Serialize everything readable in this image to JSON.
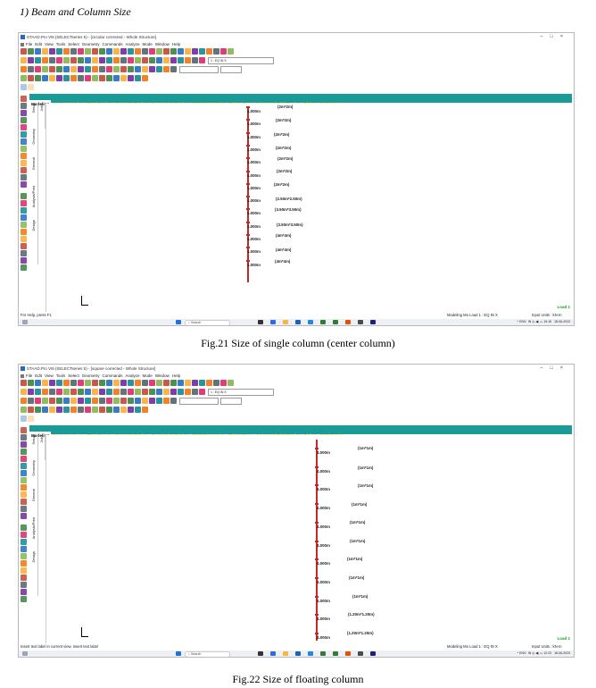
{
  "heading": "1)     Beam and Column Size",
  "captions": [
    "Fig.21 Size of single column (center column)",
    "Fig.22 Size of floating column"
  ],
  "windows": [
    {
      "title": "STAAD.Pro V8i (SELECTseries 5) - [circular corrected - Whole Structure]",
      "menu": [
        "File",
        "Edit",
        "View",
        "Tools",
        "Select",
        "Geometry",
        "Commands",
        "Analyze",
        "Mode",
        "Window",
        "Help"
      ],
      "load_combo": "1 : EQ IN X",
      "tabs": [
        "Modeling",
        "Postprocessing",
        "Steel Design",
        "Concrete Design",
        "Foundation Design",
        "RAM Connection",
        "Bridge Deck",
        "Advanced Slab Design",
        "Piping",
        "Earthquake"
      ],
      "side_tabs": [
        "Setup",
        "Geometry",
        "General",
        "Analysis/Print",
        "Design"
      ],
      "side_tabs2": [
        "Job"
      ],
      "heights": [
        "4.000m",
        "4.000m",
        "4.000m",
        "4.000m",
        "4.000m",
        "4.000m",
        "4.000m",
        "4.000m",
        "4.000m",
        "4.000m",
        "4.000m",
        "4.000m",
        "4.000m"
      ],
      "sizes": [
        "(2m*2m)",
        "(2m*2m)",
        "(2m*2m)",
        "(2m*2m)",
        "(2m*2m)",
        "(2m*2m)",
        "(2m*2m)",
        "(2.50m*2.50m)",
        "(3.50m*3.50m)",
        "(3.50m*3.50m)",
        "(4m*4m)",
        "(4m*4m)",
        "(4m*4m)"
      ],
      "load_label": "Load 1",
      "status_left": "For Help, press F1",
      "status_mid": "Modeling Mo Load 1 : EQ IN X",
      "status_right": "Input Units : kN-m",
      "search": "Search",
      "tray": {
        "lang": "ENG",
        "region": "IN",
        "time": "19:16",
        "date": "18-06-2023"
      }
    },
    {
      "title": "STAAD.Pro V8i (SELECTseries 5) - [square corrected - Whole Structure]",
      "menu": [
        "File",
        "Edit",
        "View",
        "Tools",
        "Select",
        "Geometry",
        "Commands",
        "Analyze",
        "Mode",
        "Window",
        "Help"
      ],
      "load_combo": "1 : EQ IN X",
      "tabs": [
        "Modeling",
        "Postprocessing",
        "Steel Design",
        "Concrete Design",
        "Foundation Design",
        "RAM Connection",
        "Bridge Deck",
        "Advanced Slab Design",
        "Piping",
        "Earthquake"
      ],
      "side_tabs": [
        "Setup",
        "Geometry",
        "General",
        "Analysis/Print",
        "Design"
      ],
      "side_tabs2": [
        "Job"
      ],
      "heights": [
        "4.000m",
        "4.000m",
        "4.000m",
        "4.000m",
        "4.000m",
        "4.000m",
        "4.000m",
        "4.000m",
        "4.000m",
        "4.000m",
        "4.000m"
      ],
      "sizes": [
        "(1m*1m)",
        "(1m*1m)",
        "(1m*1m)",
        "(1m*1m)",
        "(1m*1m)",
        "(1m*1m)",
        "(1m*1m)",
        "(1m*1m)",
        "(1m*1m)",
        "(1.20m*1.20m)",
        "(1.20m*1.20m)"
      ],
      "load_label": "Load 1",
      "status_left": "Insert text label in current view. Insert text label",
      "status_mid": "Modeling Mo Load 1 : EQ IN X",
      "status_right": "Input Units : kN-m",
      "search": "Search",
      "tray": {
        "lang": "ENG",
        "region": "IN",
        "time": "12:23",
        "date": "18-06-2023"
      }
    }
  ],
  "colors": {
    "tab_bar": "#1a9b98",
    "tab_text": "#f2d129",
    "column": "#c62828",
    "load_label": "#1c9e1c"
  },
  "icons": [
    "staad-app-icon",
    "minimize-icon",
    "maximize-icon",
    "close-icon",
    "windows-start-icon",
    "search-icon",
    "axis-triad-icon"
  ]
}
